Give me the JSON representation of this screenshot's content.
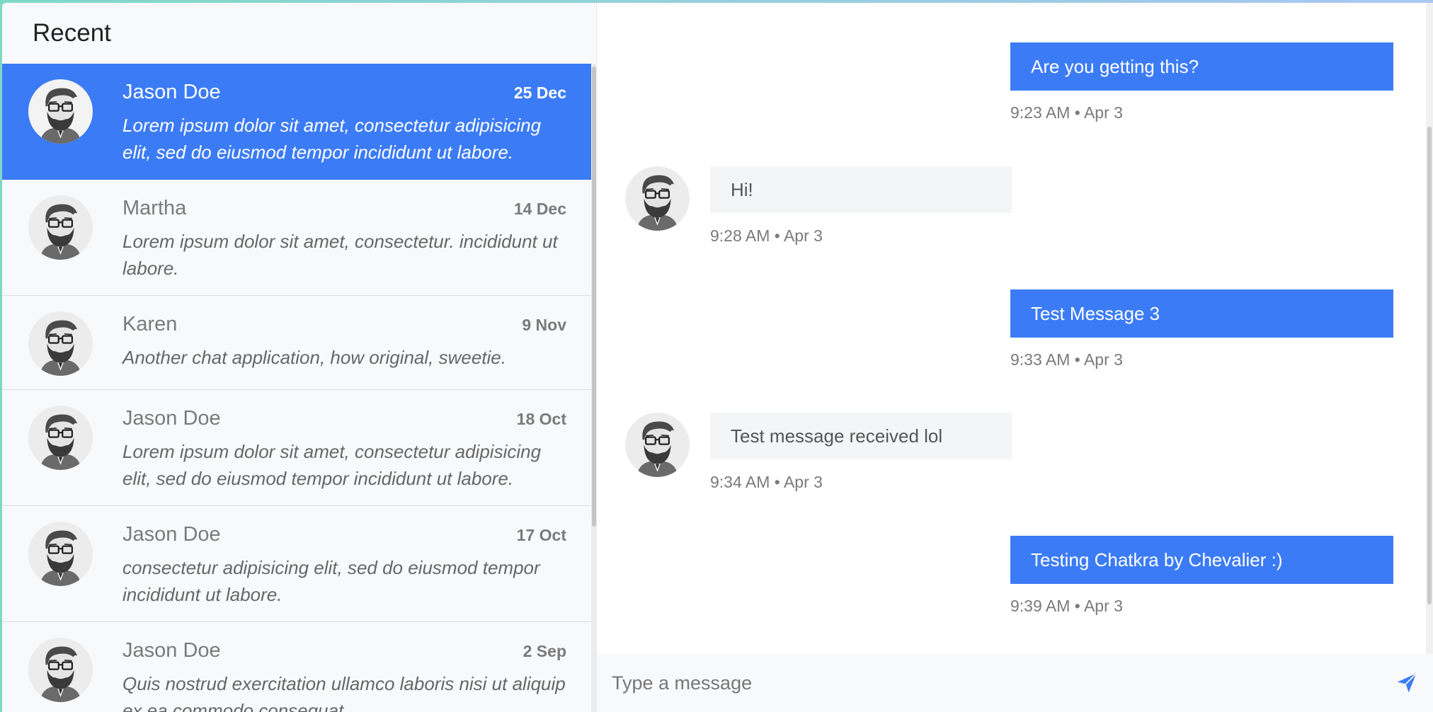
{
  "sidebar": {
    "title": "Recent",
    "conversations": [
      {
        "name": "Jason Doe",
        "date": "25 Dec",
        "preview": "Lorem ipsum dolor sit amet, consectetur adipisicing elit, sed do eiusmod tempor incididunt ut labore.",
        "active": true
      },
      {
        "name": "Martha",
        "date": "14 Dec",
        "preview": "Lorem ipsum dolor sit amet, consectetur. incididunt ut labore.",
        "active": false
      },
      {
        "name": "Karen",
        "date": "9 Nov",
        "preview": "Another chat application, how original, sweetie.",
        "active": false
      },
      {
        "name": "Jason Doe",
        "date": "18 Oct",
        "preview": "Lorem ipsum dolor sit amet, consectetur adipisicing elit, sed do eiusmod tempor incididunt ut labore.",
        "active": false
      },
      {
        "name": "Jason Doe",
        "date": "17 Oct",
        "preview": "consectetur adipisicing elit, sed do eiusmod tempor incididunt ut labore.",
        "active": false
      },
      {
        "name": "Jason Doe",
        "date": "2 Sep",
        "preview": "Quis nostrud exercitation ullamco laboris nisi ut aliquip ex ea commodo consequat.",
        "active": false
      }
    ]
  },
  "chat": {
    "messages": [
      {
        "direction": "outgoing",
        "text": "Are you getting this?",
        "time": "9:23 AM • Apr 3"
      },
      {
        "direction": "incoming",
        "text": "Hi!",
        "time": "9:28 AM • Apr 3"
      },
      {
        "direction": "outgoing",
        "text": "Test Message 3",
        "time": "9:33 AM • Apr 3"
      },
      {
        "direction": "incoming",
        "text": "Test message received lol",
        "time": "9:34 AM • Apr 3"
      },
      {
        "direction": "outgoing",
        "text": "Testing Chatkra by Chevalier :)",
        "time": "9:39 AM • Apr 3"
      }
    ],
    "composer": {
      "placeholder": "Type a message",
      "value": ""
    }
  },
  "icons": {
    "avatar": "bearded-man-avatar-icon",
    "send": "paper-plane-send-icon"
  },
  "colors": {
    "accent": "#3b7bf5",
    "incoming_bubble": "#f4f5f6",
    "sidebar_bg": "#f8f9fa"
  }
}
